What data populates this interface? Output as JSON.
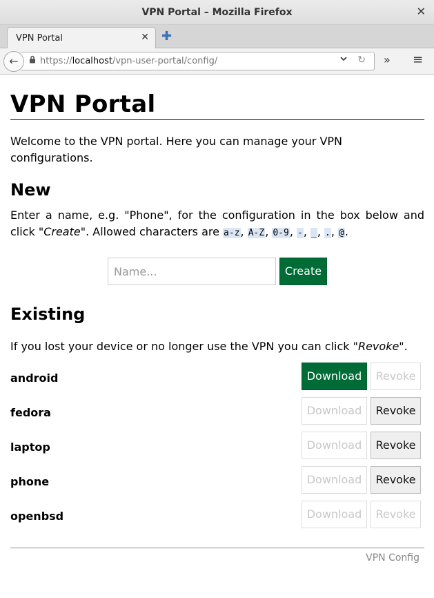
{
  "window": {
    "title": "VPN Portal – Mozilla Firefox"
  },
  "tabs": [
    {
      "label": "VPN Portal"
    }
  ],
  "navbar": {
    "url_prefix": "https://",
    "url_host": "localhost",
    "url_path": "/vpn-user-portal/config/"
  },
  "icons": {
    "close": "✕",
    "tab_close": "✕",
    "new_tab": "✚",
    "back": "←",
    "lock": "🔒",
    "dropdown": "⌄",
    "reload": "↻",
    "overflow": "»",
    "menu": "≡"
  },
  "page": {
    "heading": "VPN Portal",
    "welcome": "Welcome to the VPN portal. Here you can manage your VPN configurations."
  },
  "new_section": {
    "heading": "New",
    "intro_before": "Enter a name, e.g. \"Phone\", for the configuration in the box below and click \"",
    "intro_create": "Create",
    "intro_after": "\". Allowed characters are ",
    "allowed": [
      "a-z",
      "A-Z",
      "0-9",
      "-",
      "_",
      ".",
      "@"
    ],
    "name_placeholder": "Name...",
    "create_label": "Create"
  },
  "existing_section": {
    "heading": "Existing",
    "intro_before": "If you lost your device or no longer use the VPN you can click \"",
    "intro_revoke": "Revoke",
    "intro_after": "\".",
    "download_label": "Download",
    "revoke_label": "Revoke",
    "configs": [
      {
        "name": "android",
        "download_enabled": true,
        "revoke_enabled": false
      },
      {
        "name": "fedora",
        "download_enabled": false,
        "revoke_enabled": true
      },
      {
        "name": "laptop",
        "download_enabled": false,
        "revoke_enabled": true
      },
      {
        "name": "phone",
        "download_enabled": false,
        "revoke_enabled": true
      },
      {
        "name": "openbsd",
        "download_enabled": false,
        "revoke_enabled": false
      }
    ]
  },
  "footer": {
    "text": "VPN Config"
  },
  "colors": {
    "primary": "#006c35",
    "code_bg": "#dbe6f4"
  }
}
